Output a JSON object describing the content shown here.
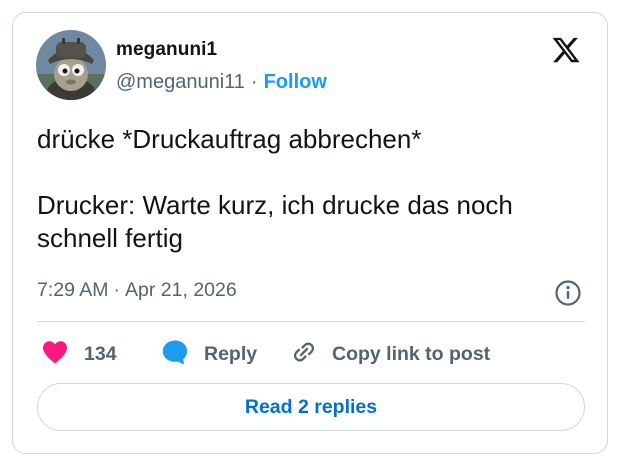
{
  "author": {
    "display_name": "meganuni1",
    "handle": "@meganuni11",
    "separator": "·",
    "follow_label": "Follow",
    "avatar_icon": "avatar-cartoon-character"
  },
  "tweet": {
    "text": "drücke *Druckauftrag abbrechen*\n\nDrucker: Warte kurz, ich drucke das noch schnell fertig",
    "time": "7:29 AM",
    "separator": "·",
    "date": "Apr 21, 2026"
  },
  "actions": {
    "like_count": "134",
    "reply_label": "Reply",
    "copy_link_label": "Copy link to post",
    "read_replies_label": "Read 2 replies"
  },
  "icons": {
    "brand": "x-logo-icon",
    "info": "info-icon",
    "like": "heart-icon",
    "reply": "speech-bubble-icon",
    "copy": "link-icon"
  },
  "colors": {
    "accent": "#1d9bf0",
    "link": "#006fd6",
    "heart": "#f91880",
    "muted": "#536471",
    "text": "#0f1419",
    "border": "#cfd9de"
  }
}
